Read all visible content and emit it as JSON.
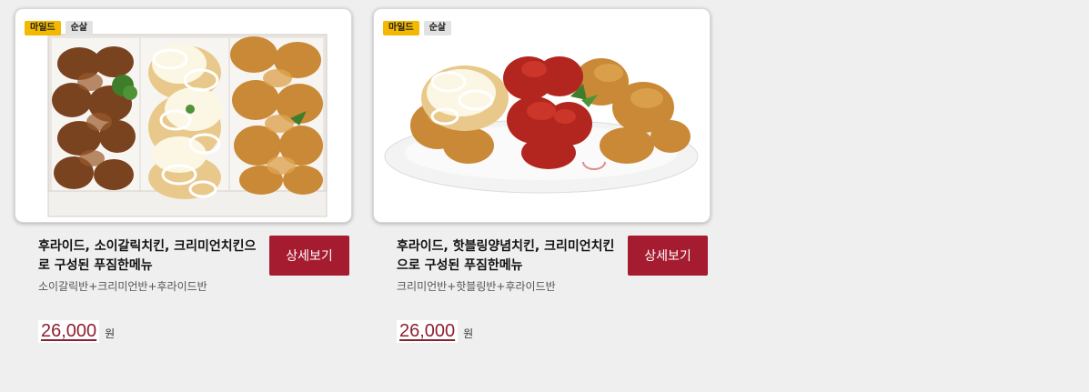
{
  "products": [
    {
      "tags": [
        "마일드",
        "순살"
      ],
      "title": "후라이드, 소이갈릭치킨, 크리미언치킨으로 구성된 푸짐한메뉴",
      "subtitle": "소이갈릭반+크리미언반+후라이드반",
      "button_label": "상세보기",
      "price": "26,000",
      "currency": "원",
      "image_icon": "chicken-box-image"
    },
    {
      "tags": [
        "마일드",
        "순살"
      ],
      "title": "후라이드, 핫블링양념치킨, 크리미언치킨으로 구성된 푸짐한메뉴",
      "subtitle": "크리미언반+핫블링반+후라이드반",
      "button_label": "상세보기",
      "price": "26,000",
      "currency": "원",
      "image_icon": "chicken-plate-image"
    }
  ],
  "colors": {
    "accent": "#a51c30",
    "price": "#8e1f2e",
    "tag_mild": "#f3b800",
    "tag_boneless": "#e2e2e2"
  }
}
